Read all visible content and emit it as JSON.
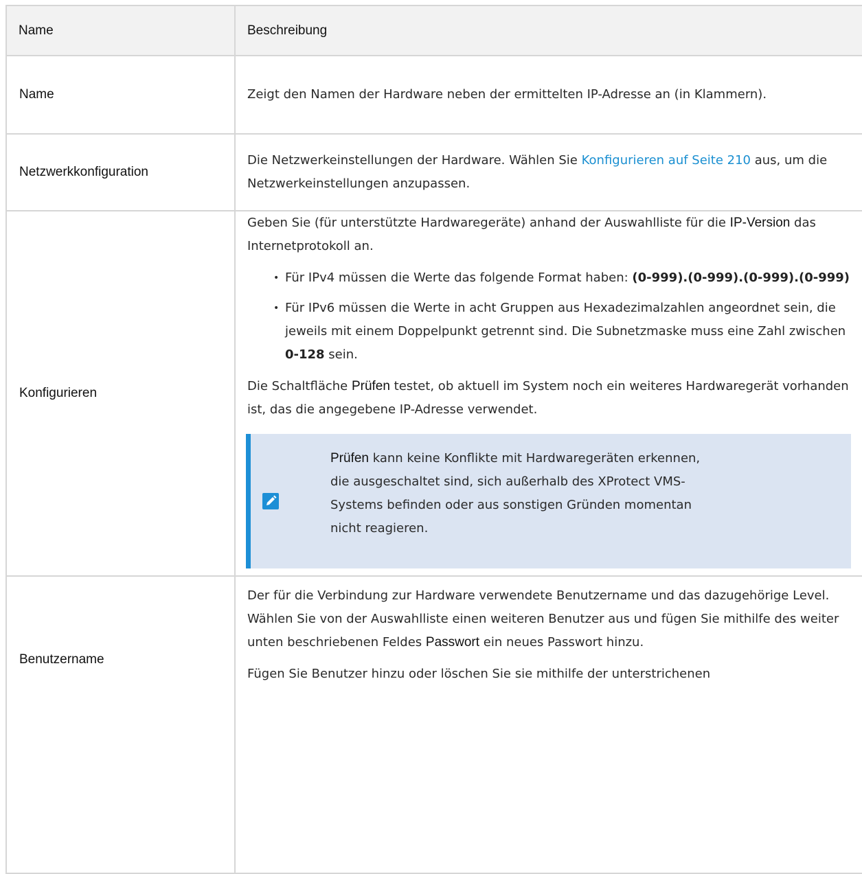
{
  "header": {
    "col_name": "Name",
    "col_desc": "Beschreibung"
  },
  "rows": [
    {
      "name": "Name",
      "desc": "Zeigt den Namen der Hardware neben der ermittelten IP-Adresse an (in Klammern)."
    },
    {
      "name": "Netzwerkkonfiguration",
      "desc_pre": "Die Netzwerkeinstellungen der Hardware. Wählen Sie ",
      "desc_link": "Konfigurieren auf Seite 210",
      "desc_post": " aus, um die Netzwerkeinstellungen anzupassen."
    },
    {
      "name": "Konfigurieren",
      "p1_pre": "Geben Sie (für unterstützte Hardwaregeräte) anhand der Auswahlliste für die ",
      "p1_label": "IP-Version",
      "p1_post": "  das Internetprotokoll an.",
      "bullet1_pre": "Für IPv4 müssen die Werte das folgende Format haben: ",
      "bullet1_bold": "(0-999).(0-999).(0-999).(0-999)",
      "bullet2_pre": "Für IPv6 müssen die Werte in acht Gruppen aus Hexadezimalzahlen angeordnet sein, die jeweils mit einem Doppelpunkt getrennt sind. Die Subnetzmaske muss eine Zahl zwischen ",
      "bullet2_bold": "0-128",
      "bullet2_post": " sein.",
      "p2_pre": "Die Schaltfläche ",
      "p2_label": "Prüfen",
      "p2_post": " testet, ob aktuell im System noch ein weiteres Hardwaregerät vorhanden ist, das die angegebene IP-Adresse verwendet.",
      "note_label": "Prüfen",
      "note_text": " kann keine Konflikte mit Hardwaregeräten erkennen, die ausgeschaltet sind, sich außerhalb des XProtect VMS-Systems befinden oder aus sonstigen Gründen momentan nicht reagieren."
    },
    {
      "name": "Benutzername",
      "p1_pre": "Der für die Verbindung zur Hardware verwendete Benutzername und das dazugehörige Level. Wählen Sie von der Auswahlliste einen weiteren Benutzer aus und fügen Sie mithilfe des weiter unten beschriebenen Feldes ",
      "p1_label": "Passwort",
      "p1_post": " ein neues Passwort hinzu.",
      "p2": "Fügen Sie Benutzer hinzu oder löschen Sie sie mithilfe der unterstrichenen"
    }
  ],
  "colors": {
    "link": "#1a8fd1",
    "note_bg": "#dbe4f2",
    "note_bar": "#1d8fd6"
  },
  "icons": {
    "note": "pencil-icon"
  }
}
